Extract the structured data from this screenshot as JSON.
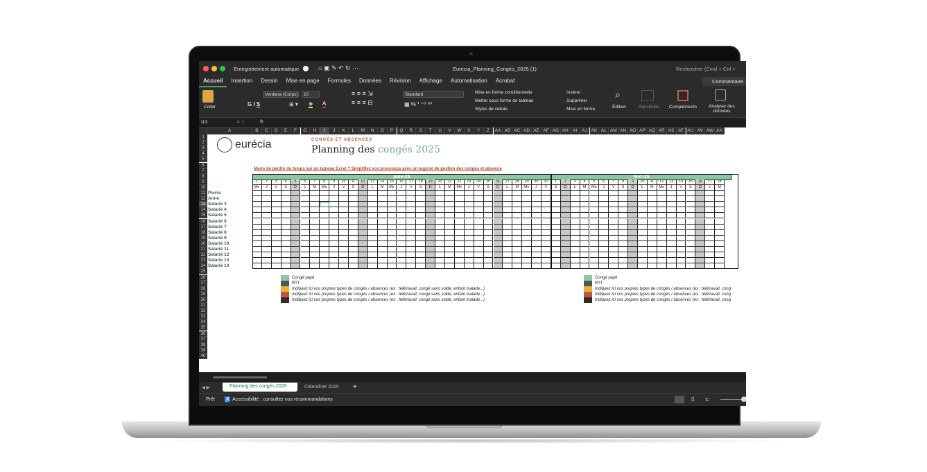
{
  "window": {
    "autosave_label": "Enregistrement automatique",
    "file_title": "Eurecia_Planning_Congés_2025 (1)",
    "search_placeholder": "Rechercher (Cmd + Ctrl +"
  },
  "ribbon_tabs": [
    "Accueil",
    "Insertion",
    "Dessin",
    "Mise en page",
    "Formules",
    "Données",
    "Révision",
    "Affichage",
    "Automatisation",
    "Acrobat"
  ],
  "comment_label": "Commentaire",
  "ribbon": {
    "paste": "Coller",
    "font": "Verdana (Corps)",
    "size": "10",
    "number_format": "Standard",
    "cond_format": "Mise en forme conditionnelle",
    "table_format": "Mettre sous forme de tableau",
    "cell_styles": "Styles de cellule",
    "insert": "Insérer",
    "delete": "Supprimer",
    "format": "Mise en forme",
    "edit": "Édition",
    "sensitivity": "Sensibilité",
    "addins": "Compléments",
    "analyze": "Analyser des données"
  },
  "formula_bar": {
    "cell_ref": "I13",
    "fx": "fx"
  },
  "columns": [
    "A",
    "B",
    "C",
    "D",
    "E",
    "F",
    "G",
    "H",
    "I",
    "J",
    "K",
    "L",
    "M",
    "N",
    "O",
    "P",
    "Q",
    "R",
    "S",
    "T",
    "U",
    "V",
    "W",
    "X",
    "Y",
    "Z",
    "AA",
    "AB",
    "AC",
    "AD",
    "AE",
    "AF",
    "AG",
    "AH",
    "AI",
    "AJ",
    "AK",
    "AL",
    "AM",
    "AN",
    "AO",
    "AP",
    "AQ",
    "AR",
    "AS",
    "AT",
    "AU",
    "AV",
    "AW",
    "AX"
  ],
  "rows": [
    "1",
    "2",
    "3",
    "4",
    "5",
    "6",
    "7",
    "8",
    "9",
    "10",
    "11",
    "12",
    "13",
    "14",
    "15",
    "16",
    "17",
    "18",
    "19",
    "20",
    "21",
    "22",
    "23",
    "24",
    "25",
    "26",
    "27",
    "28",
    "29",
    "30",
    "31",
    "32",
    "33",
    "34",
    "35",
    "36",
    "37",
    "38",
    "39",
    "40"
  ],
  "logo_text": "eurécia",
  "subtitle": "CONGÉS ET ABSENCES",
  "title_a": "Planning des ",
  "title_b": "congés 2025",
  "promo_link": "Marre de perdre du temps sur un tableau Excel ? Simplifiez vos processus avec un logiciel de gestion des congés et absence",
  "months": [
    "janv-25",
    "févr-25"
  ],
  "jan_days": [
    "Me",
    "J",
    "V",
    "S",
    "D",
    "L",
    "M",
    "Me",
    "J",
    "V",
    "S",
    "D",
    "L",
    "M",
    "Me",
    "J",
    "V",
    "S",
    "D",
    "L",
    "M",
    "Me",
    "J",
    "V",
    "S",
    "D",
    "L",
    "M",
    "Me",
    "J",
    "V"
  ],
  "feb_days": [
    "S",
    "D",
    "L",
    "M",
    "Me",
    "J",
    "V",
    "S",
    "D",
    "L",
    "M",
    "Me",
    "J",
    "V",
    "S",
    "D",
    "L",
    "M"
  ],
  "employees": [
    "Pierre",
    "Anne",
    "Salarié 3",
    "Salarié 4",
    "Salarié 5",
    "Salarié 6",
    "Salarié 7",
    "Salarié 8",
    "Salarié 9",
    "Salarié 10",
    "Salarié 11",
    "Salarié 12",
    "Salarié 13",
    "Salarié 14"
  ],
  "legend": [
    {
      "label": "Congé payé",
      "color": "#8cc7a3"
    },
    {
      "label": "RTT",
      "color": "#4a5a56"
    },
    {
      "label": "Indiquez ici vos propres types de congés / absences (ex : télétravail, congé sans solde, enfant malade...)",
      "color": "#e8b13c"
    },
    {
      "label": "Indiquez ici vos propres types de congés / absences (ex : télétravail, congé sans solde, enfant malade...)",
      "color": "#c0573a"
    },
    {
      "label": "Indiquez ici vos propres types de congés / absences (ex : télétravail, congé sans solde, enfant malade...)",
      "color": "#2f2a2c"
    }
  ],
  "legend_right": [
    {
      "label": "Congé payé",
      "color": "#8cc7a3"
    },
    {
      "label": "RTT",
      "color": "#4a5a56"
    },
    {
      "label": "Indiquez ici vos propres types de congés / absences (ex : télétravail, cong",
      "color": "#e8b13c"
    },
    {
      "label": "Indiquez ici vos propres types de congés / absences (ex : télétravail, cong",
      "color": "#c0573a"
    },
    {
      "label": "Indiquez ici vos propres types de congés / absences (ex : télétravail, cong",
      "color": "#2f2a2c"
    }
  ],
  "sheet_tabs": [
    "Planning des congés 2025",
    "Calendrier 2025"
  ],
  "status": {
    "ready": "Prêt",
    "accessibility": "Accessibilité : consultez nos recommandations"
  }
}
